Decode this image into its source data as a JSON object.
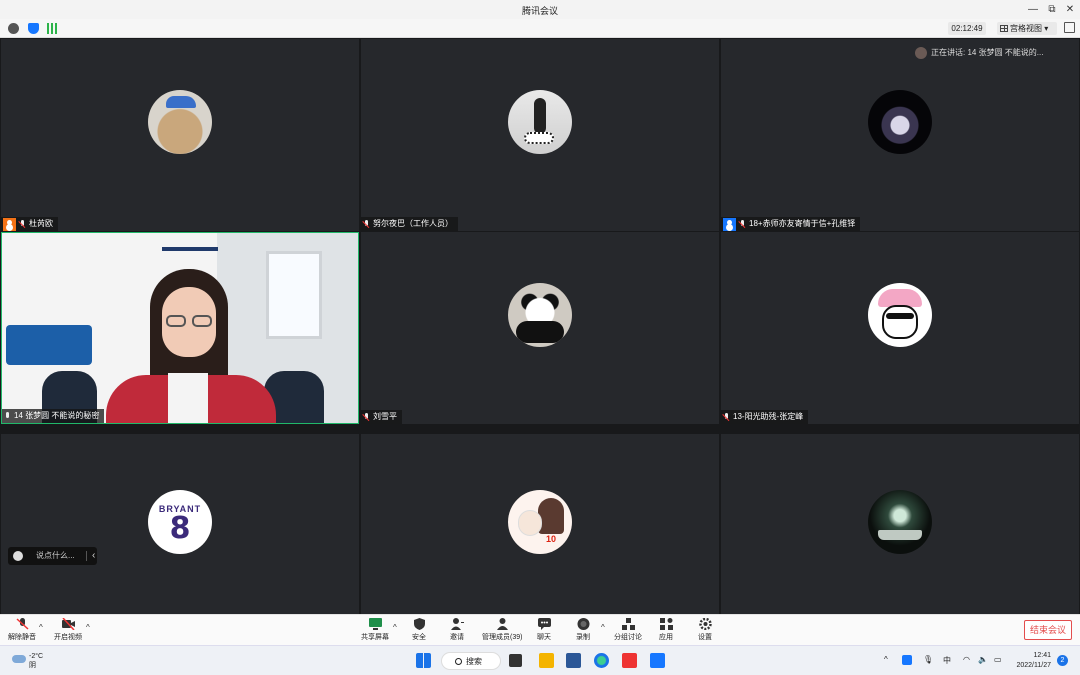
{
  "window": {
    "title": "腾讯会议",
    "controls": [
      "—",
      "⧉",
      "✕"
    ]
  },
  "toolbar": {
    "timer": "02:12:49",
    "view_label": "宫格视图"
  },
  "speaking_label": "正在讲话: 14 张梦圆 不能说的...",
  "participants": [
    {
      "name": "杜芮欧",
      "role": "host"
    },
    {
      "name": "努尔夜巴（工作人员）"
    },
    {
      "name": "18+赤师亦友寄情于信+孔维铎",
      "role": "cohost"
    },
    {
      "name": "14 张梦圆 不能说的秘密",
      "video": true
    },
    {
      "name": "刘雪平"
    },
    {
      "name": "13-阳光助残-张定峰"
    },
    {
      "name": ""
    },
    {
      "name": ""
    },
    {
      "name": ""
    }
  ],
  "avatar_texts": {
    "jersey_name": "BRYANT",
    "jersey_number": "8",
    "sticker_number": "10"
  },
  "chat_placeholder": "说点什么...",
  "controls": {
    "unmute": "解除静音",
    "start_video": "开启视频",
    "share_screen": "共享屏幕",
    "security": "安全",
    "invite": "邀请",
    "manage_members": "管理成员(39)",
    "chat": "聊天",
    "record": "录制",
    "breakout": "分组讨论",
    "apps": "应用",
    "settings": "设置",
    "end_meeting": "结束会议"
  },
  "taskbar": {
    "temperature": "-2°C",
    "weather": "阴",
    "search": "搜索",
    "ime": "中",
    "time": "12:41",
    "date": "2022/11/27",
    "notifications": "2"
  },
  "colors": {
    "accent": "#1677ff",
    "active_border": "#21b86a",
    "end": "#e34d4d",
    "host_badge": "#f47216"
  }
}
